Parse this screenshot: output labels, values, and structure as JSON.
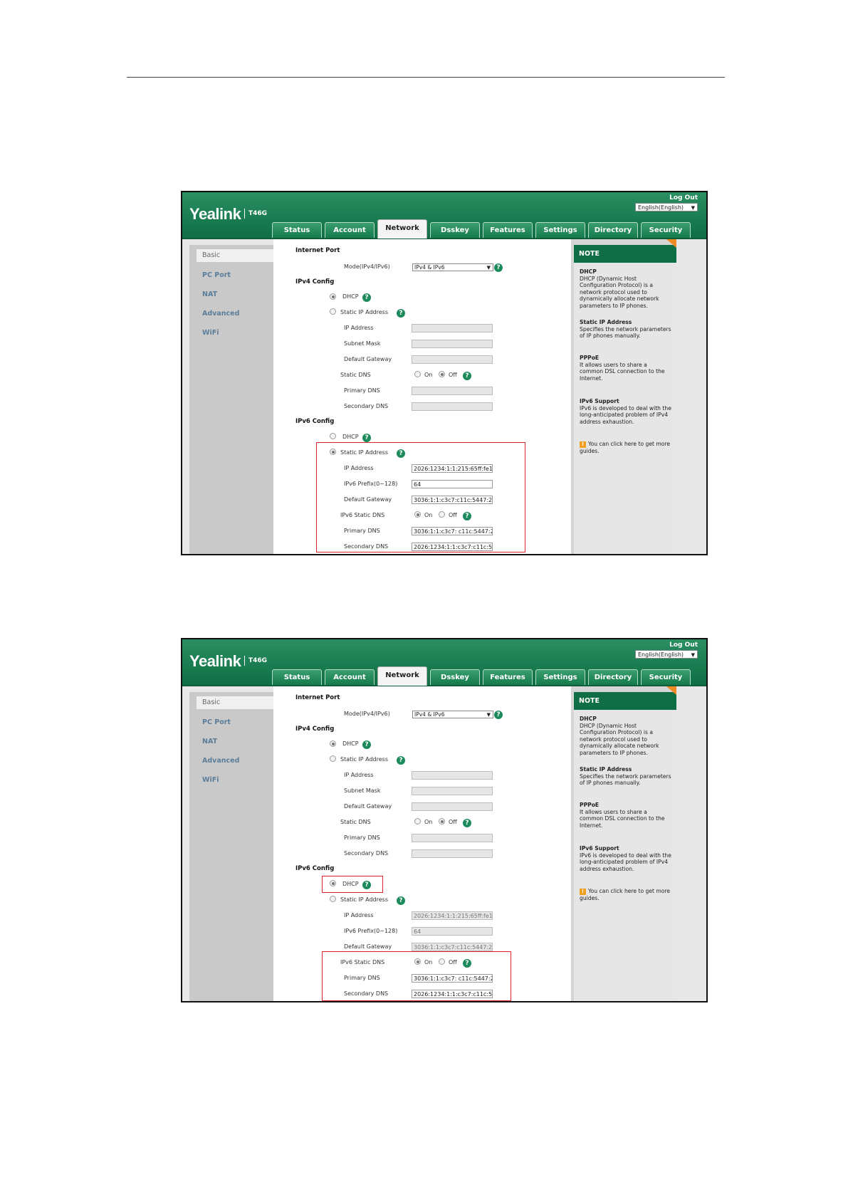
{
  "header": {
    "logo": "Yealink",
    "model": "T46G",
    "logout": "Log Out",
    "language": "English(English)"
  },
  "tabs": [
    "Status",
    "Account",
    "Network",
    "Dsskey",
    "Features",
    "Settings",
    "Directory",
    "Security"
  ],
  "sidebar": [
    "Basic",
    "PC Port",
    "NAT",
    "Advanced",
    "WiFi"
  ],
  "form": {
    "internet_port": "Internet Port",
    "mode_label": "Mode(IPv4/IPv6)",
    "mode_value": "IPv4 & IPv6",
    "ipv4_config": "IPv4 Config",
    "dhcp": "DHCP",
    "static_ip": "Static IP Address",
    "ip_address": "IP Address",
    "subnet_mask": "Subnet Mask",
    "default_gateway": "Default Gateway",
    "static_dns": "Static DNS",
    "on": "On",
    "off": "Off",
    "primary_dns": "Primary DNS",
    "secondary_dns": "Secondary DNS",
    "ipv6_config": "IPv6 Config",
    "ipv6_prefix": "IPv6 Prefix(0~128)",
    "ipv6_static_dns": "IPv6 Static DNS"
  },
  "values": {
    "ipv6_ip": "2026:1234:1:1:215:65ff:fe1",
    "ipv6_prefix": "64",
    "ipv6_gateway": "3036:1:1:c3c7:c11c:5447:2",
    "ipv6_primary_dns": "3036:1:1:c3c7: c11c:5447:2",
    "ipv6_secondary_dns": "2026:1234:1:1:c3c7:c11c:5"
  },
  "note": {
    "title": "NOTE",
    "dhcp_title": "DHCP",
    "dhcp_text": "DHCP (Dynamic Host Configuration Protocol) is a network protocol used to dynamically allocate network parameters to IP phones.",
    "static_title": "Static IP Address",
    "static_text": "Specifies the network parameters of IP phones manually.",
    "pppoe_title": "PPPoE",
    "pppoe_text": "It allows users to share a common DSL connection to the Internet.",
    "ipv6_title": "IPv6 Support",
    "ipv6_text": "IPv6 is developed to deal with the long-anticipated problem of IPv4 address exhaustion.",
    "guide_text": "You can click here to get more guides."
  },
  "colors": {
    "brand_green": "#0f6e45",
    "highlight_red": "#e0222a",
    "note_accent": "#f08a22"
  },
  "icons": [
    "help-icon",
    "guide-icon",
    "dropdown-arrow-icon"
  ]
}
